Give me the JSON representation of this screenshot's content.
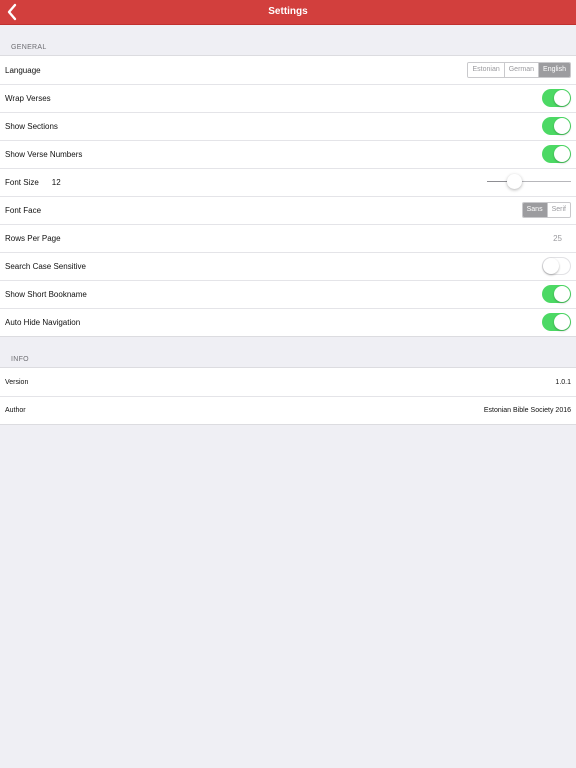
{
  "navbar": {
    "title": "Settings",
    "back_icon": "chevron-left-icon",
    "color": "#d23f3d"
  },
  "general": {
    "header": "GENERAL",
    "language": {
      "label": "Language",
      "options": [
        "Estonian",
        "German",
        "English"
      ],
      "selected": "English"
    },
    "wrap_verses": {
      "label": "Wrap Verses",
      "on": true
    },
    "show_sections": {
      "label": "Show Sections",
      "on": true
    },
    "show_verse_numbers": {
      "label": "Show Verse Numbers",
      "on": true
    },
    "font_size": {
      "label": "Font Size",
      "value": "12",
      "slider_fraction": 0.32
    },
    "font_face": {
      "label": "Font Face",
      "options": [
        "Sans",
        "Serif"
      ],
      "selected": "Sans"
    },
    "rows_per_page": {
      "label": "Rows Per Page",
      "value": "25"
    },
    "search_case_sensitive": {
      "label": "Search Case Sensitive",
      "on": false
    },
    "show_short_bookname": {
      "label": "Show Short Bookname",
      "on": true
    },
    "auto_hide_navigation": {
      "label": "Auto Hide Navigation",
      "on": true
    }
  },
  "info": {
    "header": "INFO",
    "version": {
      "label": "Version",
      "value": "1.0.1"
    },
    "author": {
      "label": "Author",
      "value": "Estonian Bible Society 2016"
    }
  },
  "colors": {
    "toggle_on": "#4cd964",
    "segment_selected": "#9c9c9f",
    "background": "#efeff4"
  }
}
